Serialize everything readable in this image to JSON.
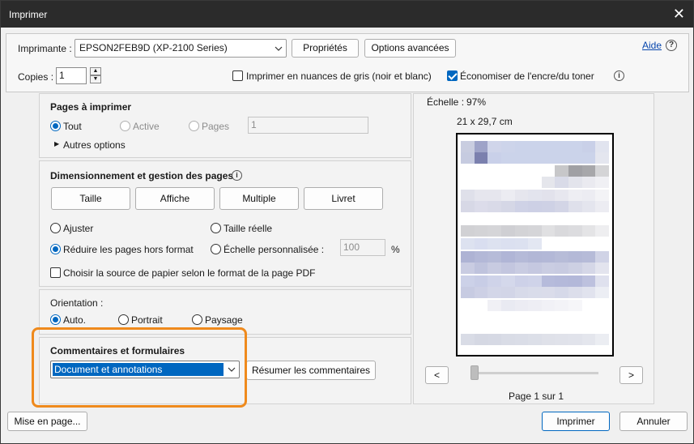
{
  "window": {
    "title": "Imprimer",
    "close_glyph": "✕"
  },
  "printer": {
    "label": "Imprimante :",
    "selected": "EPSON2FEB9D (XP-2100 Series)",
    "properties_button": "Propriétés",
    "advanced_button": "Options avancées"
  },
  "help": {
    "label": "Aide",
    "icon_glyph": "?"
  },
  "copies": {
    "label": "Copies :",
    "value": "1",
    "up_glyph": "▲",
    "down_glyph": "▼"
  },
  "options": {
    "grayscale_label": "Imprimer en nuances de gris (noir et blanc)",
    "grayscale_checked": false,
    "save_ink_label": "Économiser de l'encre/du toner",
    "save_ink_checked": true,
    "info_glyph": "i"
  },
  "pages_section": {
    "title": "Pages à imprimer",
    "all": "Tout",
    "active": "Active",
    "pages": "Pages",
    "pages_value": "1",
    "more_options": "Autres options",
    "more_glyph": "▶"
  },
  "sizing_section": {
    "title": "Dimensionnement et gestion des pages",
    "info_glyph": "i",
    "buttons": [
      "Taille",
      "Affiche",
      "Multiple",
      "Livret"
    ],
    "fit": "Ajuster",
    "actual_size": "Taille réelle",
    "shrink": "Réduire les pages hors format",
    "custom_scale": "Échelle personnalisée :",
    "scale_value": "100",
    "percent": "%",
    "paper_source": "Choisir la source de papier selon le format de la page PDF"
  },
  "orientation_section": {
    "title": "Orientation :",
    "auto": "Auto.",
    "portrait": "Portrait",
    "landscape": "Paysage"
  },
  "comments_section": {
    "title": "Commentaires et formulaires",
    "selected": "Document et annotations",
    "summarize_button": "Résumer les commentaires"
  },
  "preview": {
    "scale_label": "Échelle :",
    "scale_value": "97%",
    "paper_size": "21 x 29,7 cm",
    "prev_glyph": "<",
    "next_glyph": ">",
    "page_info": "Page 1 sur 1"
  },
  "footer": {
    "page_setup_button": "Mise en page...",
    "print_button": "Imprimer",
    "cancel_button": "Annuler"
  },
  "colors": {
    "accent": "#0067c0",
    "highlight_border": "#ef8a1d",
    "titlebar": "#2b2b2b"
  }
}
